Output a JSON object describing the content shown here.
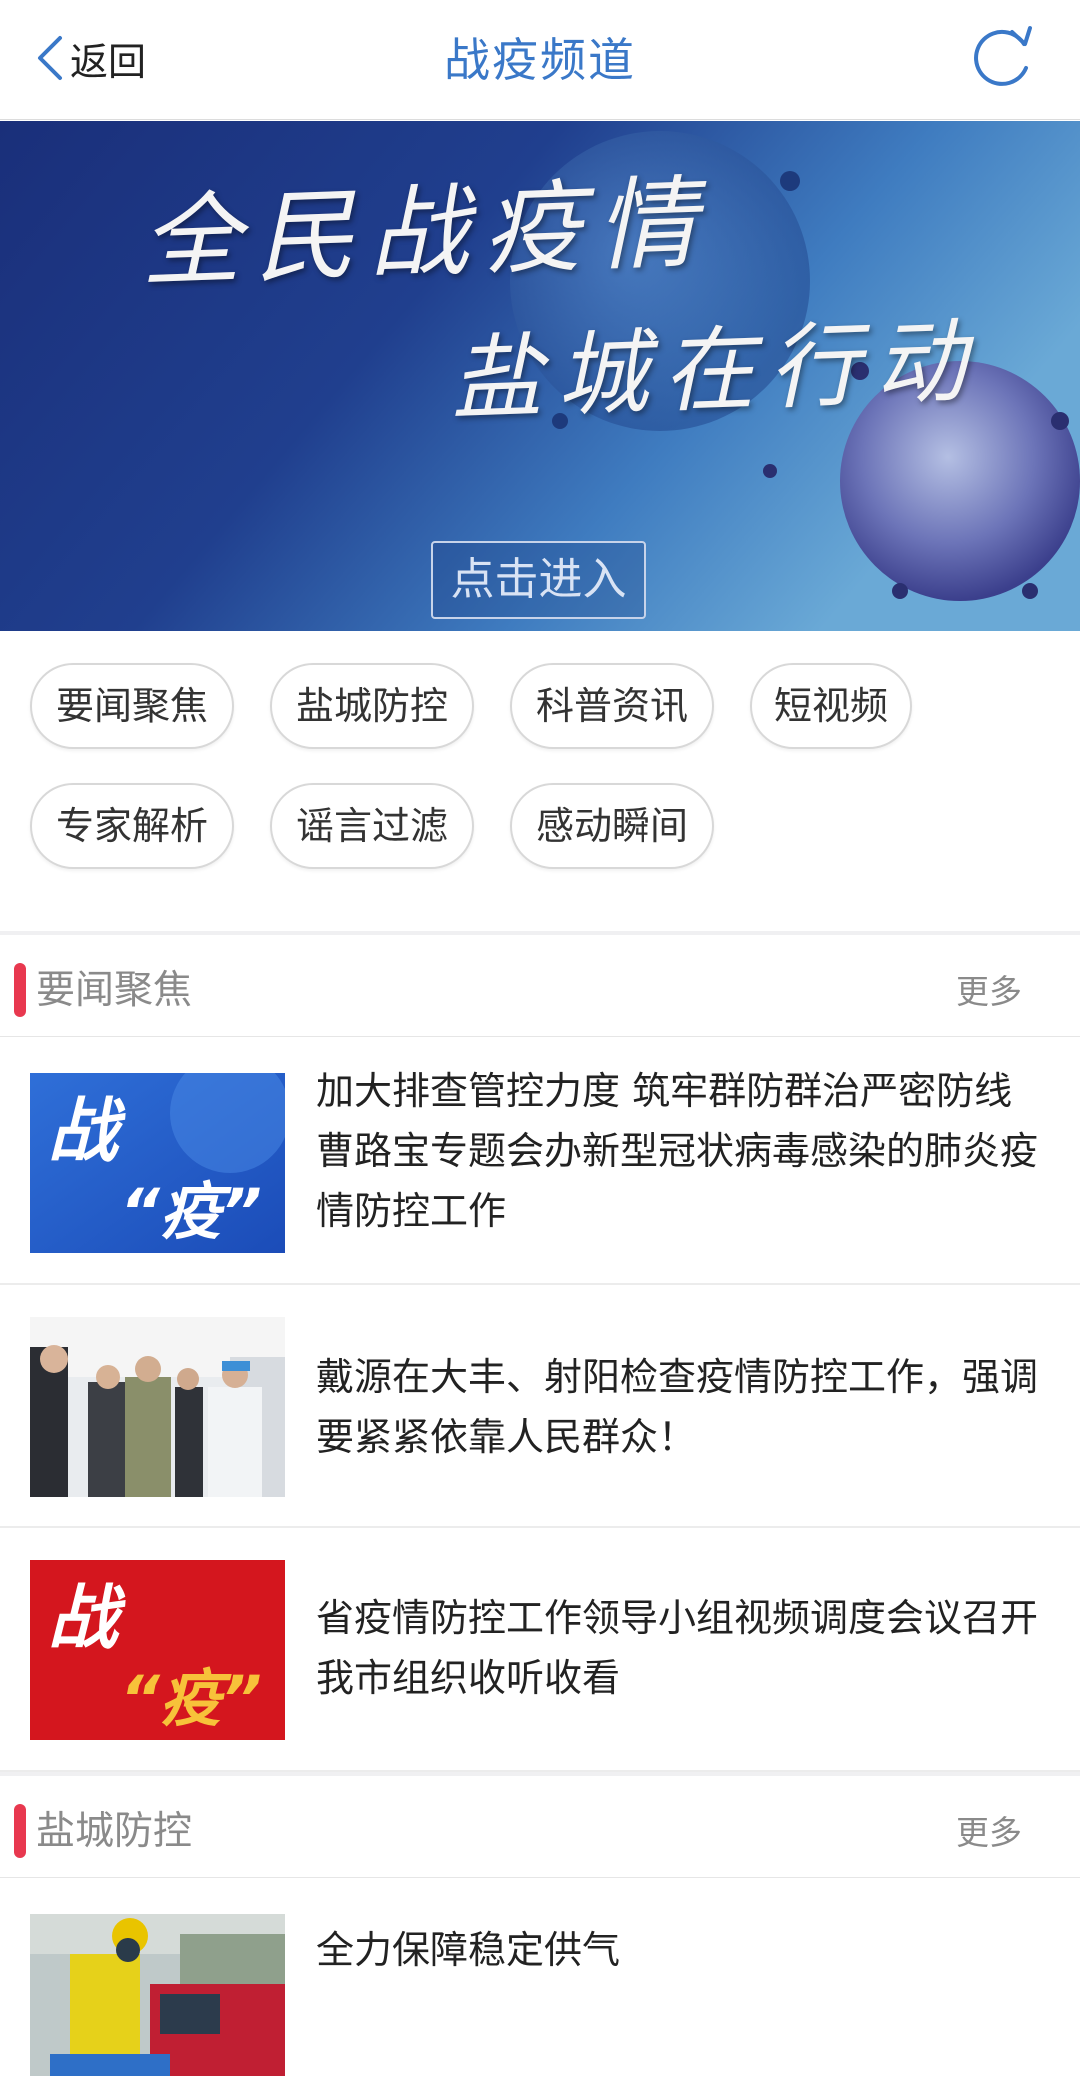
{
  "topbar": {
    "back_label": "返回",
    "title": "战疫频道"
  },
  "banner": {
    "line1": "全民战疫情",
    "line2": "盐城在行动",
    "button_label": "点击进入"
  },
  "tags": [
    "要闻聚焦",
    "盐城防控",
    "科普资讯",
    "短视频",
    "专家解析",
    "谣言过滤",
    "感动瞬间"
  ],
  "sections": [
    {
      "title": "要闻聚焦",
      "more_label": "更多",
      "items": [
        {
          "headline": "加大排查管控力度 筑牢群防群治严密防线 曹路宝专题会办新型冠状病毒感染的肺炎疫情防控工作",
          "thumb_icon": "zhan-yi-blue-graphic",
          "thumb_text_1": "战",
          "thumb_text_2": "“疫”"
        },
        {
          "headline": "戴源在大丰、射阳检查疫情防控工作，强调要紧紧依靠人民群众！",
          "thumb_icon": "inspection-photo"
        },
        {
          "headline": "省疫情防控工作领导小组视频调度会议召开 我市组织收听收看",
          "thumb_icon": "zhan-yi-red-graphic",
          "thumb_text_1": "战",
          "thumb_text_2": "“疫”"
        }
      ]
    },
    {
      "title": "盐城防控",
      "more_label": "更多",
      "items": [
        {
          "headline": "全力保障稳定供气",
          "thumb_icon": "gas-worker-photo"
        }
      ]
    }
  ],
  "colors": {
    "title_blue": "#3a78c8",
    "accent_red": "#e8384f",
    "banner_dark": "#1a2f7a",
    "banner_light": "#6aa9d6"
  }
}
